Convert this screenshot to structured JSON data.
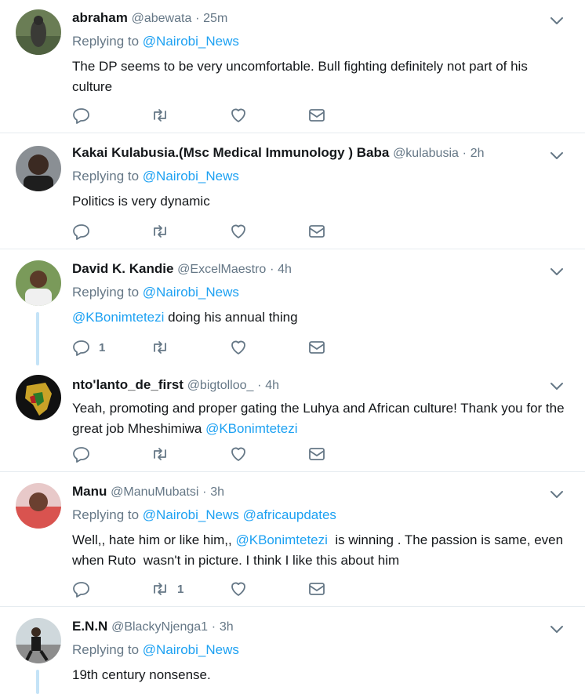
{
  "replying_label": "Replying to",
  "tweets": [
    {
      "name": "abraham",
      "handle": "@abewata",
      "dot": "·",
      "time": "25m",
      "replying_to": [
        "@Nairobi_News"
      ],
      "text_parts": [
        {
          "t": "The DP seems to be very uncomfortable. Bull fighting definitely not part of his culture"
        }
      ],
      "reply_count": "",
      "retweet_count": "",
      "like_count": ""
    },
    {
      "name": "Kakai Kulabusia.(Msc Medical Immunology ) Baba",
      "handle": "@kulabusia",
      "dot": "·",
      "time": "2h",
      "replying_to": [
        "@Nairobi_News"
      ],
      "text_parts": [
        {
          "t": "Politics is very dynamic"
        }
      ],
      "reply_count": "",
      "retweet_count": "",
      "like_count": ""
    },
    {
      "name": "David K. Kandie",
      "handle": "@ExcelMaestro",
      "dot": "·",
      "time": "4h",
      "replying_to": [
        "@Nairobi_News"
      ],
      "text_parts": [
        {
          "link": "@KBonimtetezi"
        },
        {
          "t": " doing his annual thing"
        }
      ],
      "reply_count": "1",
      "retweet_count": "",
      "like_count": ""
    },
    {
      "name": "nto'lanto_de_first",
      "handle": "@bigtolloo_",
      "dot": "·",
      "time": "4h",
      "replying_to": [],
      "text_parts": [
        {
          "t": "Yeah, promoting and proper gating the Luhya and African culture! Thank you for the great job Mheshimiwa "
        },
        {
          "link": "@KBonimtetezi"
        }
      ],
      "reply_count": "",
      "retweet_count": "",
      "like_count": ""
    },
    {
      "name": "Manu",
      "handle": "@ManuMubatsi",
      "dot": "·",
      "time": "3h",
      "replying_to": [
        "@Nairobi_News",
        "@africaupdates"
      ],
      "text_parts": [
        {
          "t": "Well,, hate him or like him,, "
        },
        {
          "link": "@KBonimtetezi"
        },
        {
          "t": "  is winning . The passion is same, even when Ruto  wasn't in picture. I think I like this about him"
        }
      ],
      "reply_count": "",
      "retweet_count": "1",
      "like_count": ""
    },
    {
      "name": "E.N.N",
      "handle": "@BlackyNjenga1",
      "dot": "·",
      "time": "3h",
      "replying_to": [
        "@Nairobi_News"
      ],
      "text_parts": [
        {
          "t": "19th century nonsense."
        }
      ],
      "reply_count": "",
      "retweet_count": "",
      "like_count": ""
    }
  ],
  "icons": {
    "reply": "reply-icon",
    "retweet": "retweet-icon",
    "like": "heart-icon",
    "dm": "envelope-icon",
    "caret": "chevron-down-icon"
  },
  "colors": {
    "link": "#1da1f2",
    "muted": "#657786",
    "text": "#14171a",
    "divider": "#e6ecf0",
    "thread_line": "#c4e3f7"
  }
}
